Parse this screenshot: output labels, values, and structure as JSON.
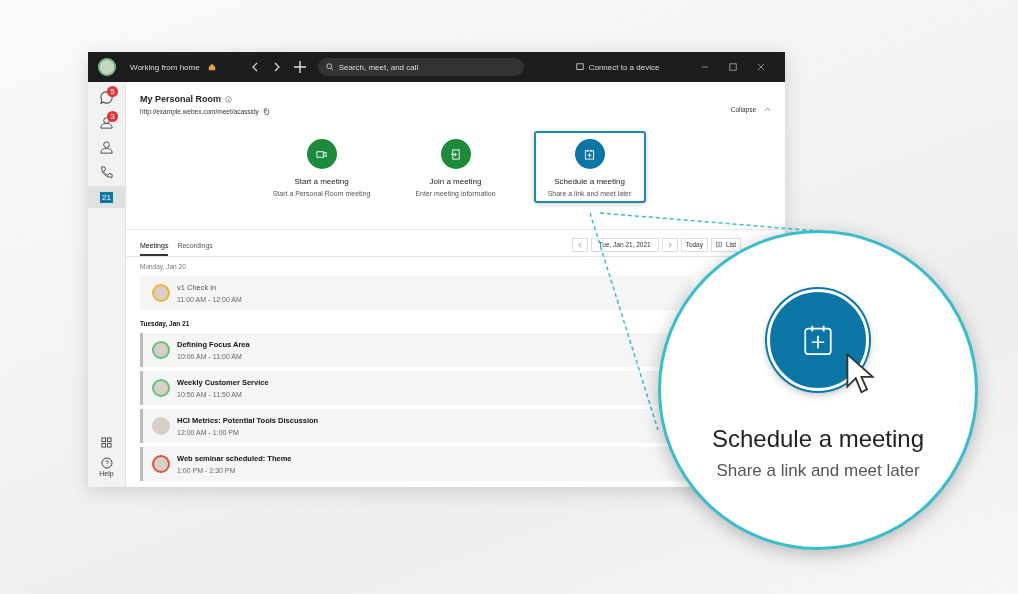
{
  "title_bar": {
    "status": "Working from home",
    "search": {
      "placeholder": "Search, meet, and call"
    },
    "connect": "Connect to a device"
  },
  "sidebar": {
    "items": [
      {
        "kind": "messages",
        "badge": "5",
        "selected": false
      },
      {
        "kind": "teams",
        "badge": "3",
        "selected": false
      },
      {
        "kind": "contacts",
        "selected": false
      },
      {
        "kind": "calls",
        "selected": false
      },
      {
        "kind": "calendar",
        "label": "21",
        "selected": true
      }
    ],
    "help": "Help"
  },
  "room": {
    "title": "My Personal Room",
    "link": "http://example.webex.com/meet/acassidy",
    "collapse": "Collapse"
  },
  "actions": [
    {
      "kind": "start",
      "title": "Start a meeting",
      "subtitle": "Start a Personal Room meeting",
      "selected": false
    },
    {
      "kind": "join",
      "title": "Join a meeting",
      "subtitle": "Enter meeting information",
      "selected": false
    },
    {
      "kind": "schedule",
      "title": "Schedule a meeting",
      "subtitle": "Share a link and meet later",
      "selected": true
    }
  ],
  "tabs": [
    {
      "label": "Meetings",
      "selected": true
    },
    {
      "label": "Recordings",
      "selected": false
    }
  ],
  "date_nav": {
    "date": "Tue, Jan 21, 2021",
    "today": "Today",
    "view": "List"
  },
  "days": [
    {
      "label": "Monday, Jan 20",
      "past": true,
      "meetings": [
        {
          "title": "v1 Check in",
          "time": "11:00 AM - 12:00 AM",
          "color": "#f2b134"
        }
      ]
    },
    {
      "label": "Tuesday, Jan 21",
      "past": false,
      "meetings": [
        {
          "title": "Defining Focus Area",
          "time": "10:00 AM - 11:00 AM",
          "color": "#5fc27e"
        },
        {
          "title": "Weekly Customer Service",
          "time": "10:50 AM - 11:50 AM",
          "color": "#5fc27e"
        },
        {
          "title": "HCI Metrics: Potential Tools Discussion",
          "time": "12:00 AM - 1:00 PM",
          "color": "#d0d0d0"
        },
        {
          "title": "Web seminar scheduled: Theme",
          "time": "1:00 PM - 2:30 PM",
          "color": "#e0533d"
        }
      ]
    }
  ],
  "callout": {
    "title": "Schedule a meeting",
    "subtitle": "Share a link and meet later"
  }
}
